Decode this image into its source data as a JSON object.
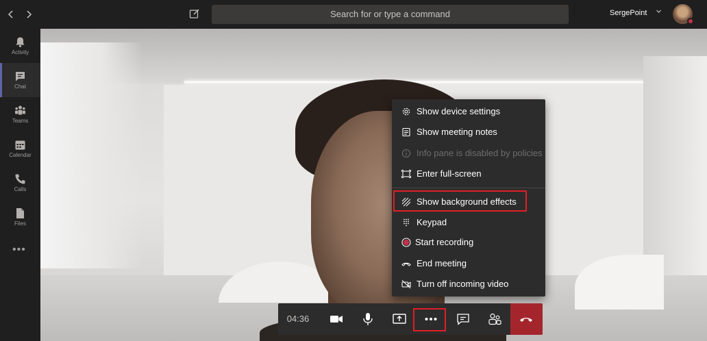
{
  "titlebar": {
    "search_placeholder": "Search for or type a command",
    "user_name": "SergePoint",
    "back_icon": "chevron-left-icon",
    "forward_icon": "chevron-right-icon",
    "compose_icon": "compose-icon"
  },
  "rail": {
    "items": [
      {
        "label": "Activity",
        "icon": "bell-icon"
      },
      {
        "label": "Chat",
        "icon": "chat-icon",
        "active": true
      },
      {
        "label": "Teams",
        "icon": "teams-icon"
      },
      {
        "label": "Calendar",
        "icon": "calendar-icon"
      },
      {
        "label": "Calls",
        "icon": "phone-icon"
      },
      {
        "label": "Files",
        "icon": "file-icon"
      }
    ],
    "more": "•••"
  },
  "menu": {
    "items": [
      {
        "label": "Show device settings",
        "icon": "gear-icon"
      },
      {
        "label": "Show meeting notes",
        "icon": "notes-icon"
      },
      {
        "label": "Info pane is disabled by policies",
        "icon": "info-icon",
        "disabled": true
      },
      {
        "label": "Enter full-screen",
        "icon": "fullscreen-icon"
      },
      {
        "label": "Show background effects",
        "icon": "background-effects-icon",
        "highlighted": true
      },
      {
        "label": "Keypad",
        "icon": "keypad-icon"
      },
      {
        "label": "Start recording",
        "icon": "record-icon"
      },
      {
        "label": "End meeting",
        "icon": "end-meeting-icon"
      },
      {
        "label": "Turn off incoming video",
        "icon": "video-off-icon"
      }
    ]
  },
  "controls": {
    "timer": "04:36",
    "more_label": "•••",
    "buttons": [
      "camera-icon",
      "microphone-icon",
      "share-screen-icon",
      "more-actions-icon",
      "chat-icon",
      "participants-icon",
      "hang-up-icon"
    ]
  },
  "colors": {
    "accent": "#6264a7",
    "highlight": "#e01f26",
    "hangup": "#a4262c",
    "menu_bg": "#2d2c2c",
    "app_bg": "#201f1f"
  }
}
